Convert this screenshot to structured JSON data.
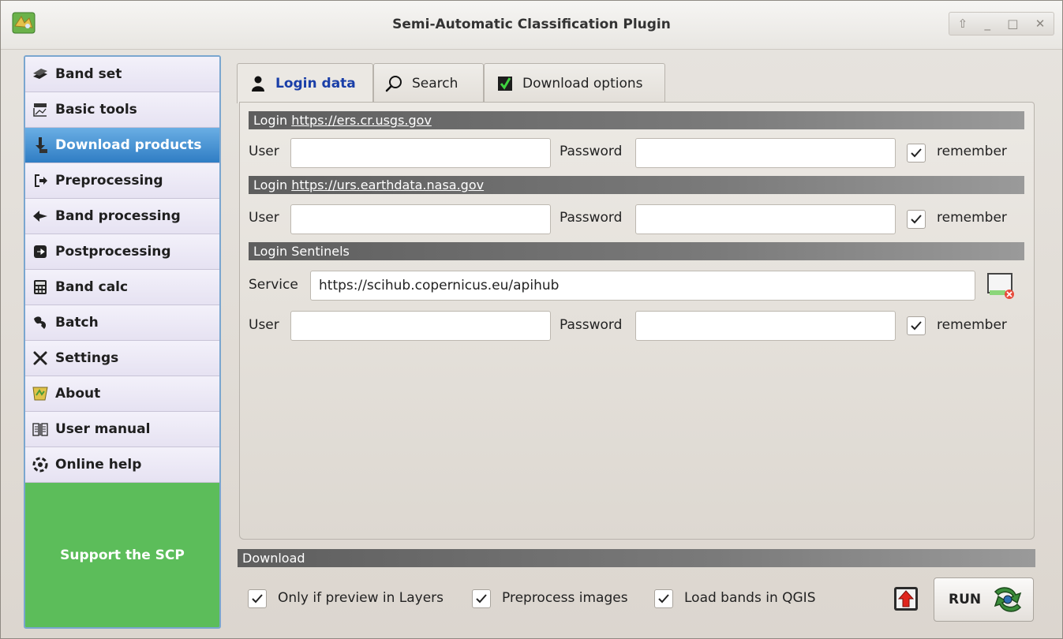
{
  "window": {
    "title": "Semi-Automatic Classification Plugin",
    "controls": [
      "⇧",
      "_",
      "□",
      "✕"
    ]
  },
  "sidebar": {
    "items": [
      {
        "label": "Band set",
        "icon": "band-set-icon"
      },
      {
        "label": "Basic tools",
        "icon": "basic-tools-icon"
      },
      {
        "label": "Download products",
        "icon": "download-icon",
        "active": true
      },
      {
        "label": "Preprocessing",
        "icon": "preprocessing-icon"
      },
      {
        "label": "Band processing",
        "icon": "band-processing-icon"
      },
      {
        "label": "Postprocessing",
        "icon": "postprocessing-icon"
      },
      {
        "label": "Band calc",
        "icon": "calculator-icon"
      },
      {
        "label": "Batch",
        "icon": "batch-icon"
      },
      {
        "label": "Settings",
        "icon": "settings-icon"
      },
      {
        "label": "About",
        "icon": "about-icon"
      },
      {
        "label": "User manual",
        "icon": "manual-icon"
      },
      {
        "label": "Online help",
        "icon": "help-icon"
      }
    ],
    "support_label": "Support the SCP"
  },
  "tabs": [
    {
      "label": "Login data",
      "icon": "user-icon",
      "active": true
    },
    {
      "label": "Search",
      "icon": "search-icon"
    },
    {
      "label": "Download options",
      "icon": "checkbox-icon"
    }
  ],
  "login_usgs": {
    "prefix": "Login ",
    "url": "https://ers.cr.usgs.gov",
    "user_label": "User",
    "user_value": "",
    "password_label": "Password",
    "password_value": "",
    "remember_label": "remember",
    "remember": true
  },
  "login_nasa": {
    "prefix": "Login ",
    "url": "https://urs.earthdata.nasa.gov",
    "user_label": "User",
    "user_value": "",
    "password_label": "Password",
    "password_value": "",
    "remember_label": "remember",
    "remember": true
  },
  "login_sentinels": {
    "title": "Login Sentinels",
    "service_label": "Service",
    "service_value": "https://scihub.copernicus.eu/apihub",
    "user_label": "User",
    "user_value": "",
    "password_label": "Password",
    "password_value": "",
    "remember_label": "remember",
    "remember": true
  },
  "download": {
    "title": "Download",
    "only_preview_label": "Only if preview in Layers",
    "preprocess_label": "Preprocess images",
    "load_bands_label": "Load bands in QGIS",
    "run_label": "RUN"
  }
}
